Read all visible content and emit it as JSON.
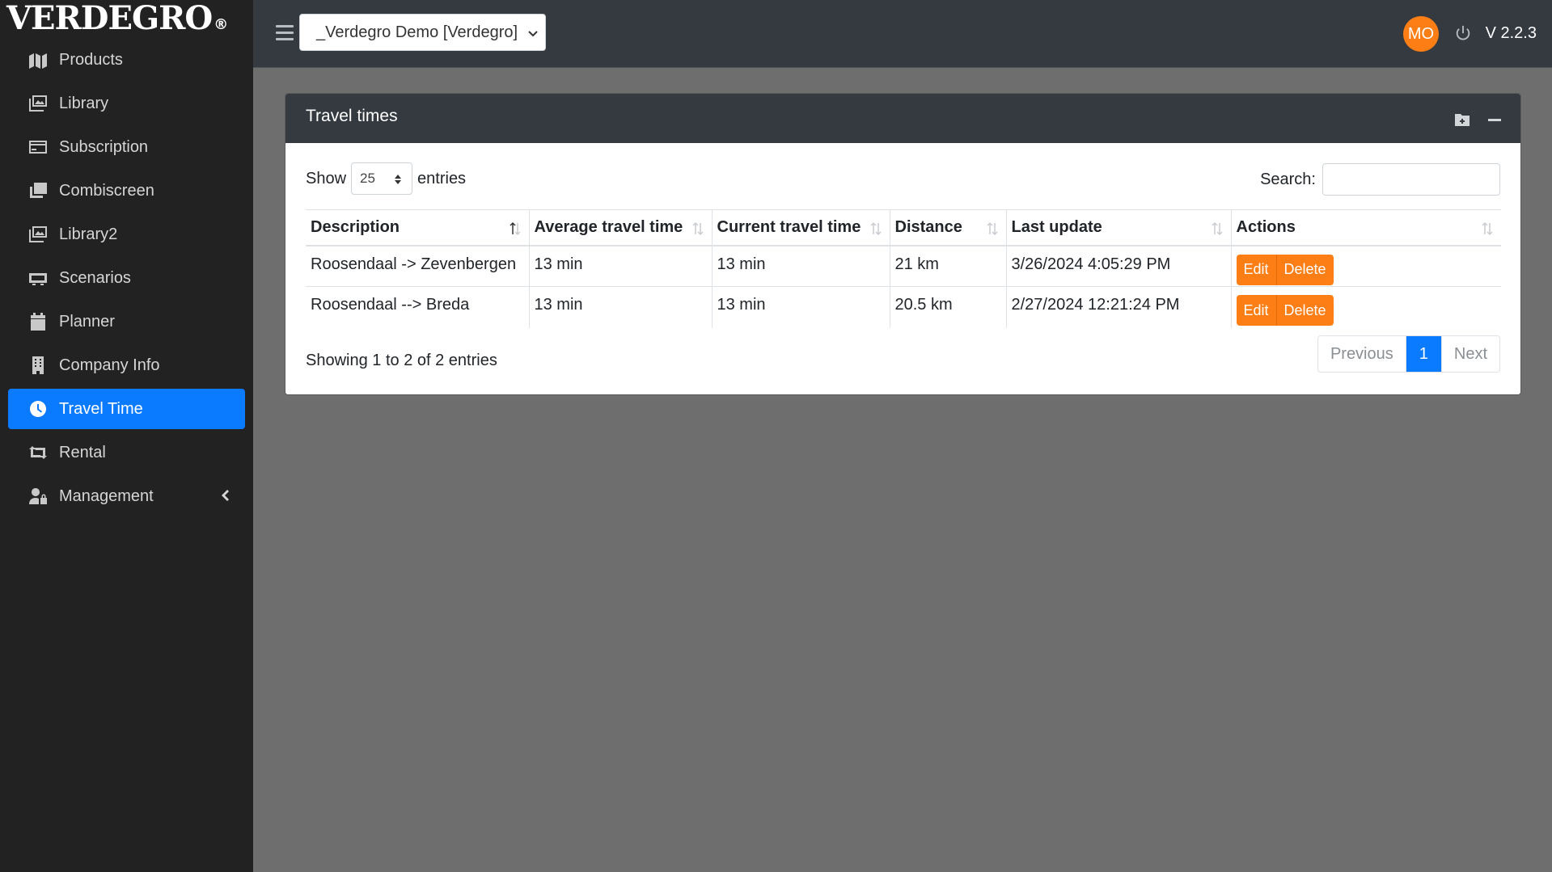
{
  "brand": {
    "name": "VERDEGRO",
    "reg_mark": "®"
  },
  "sidebar": {
    "items": [
      {
        "label": "Products",
        "icon": "map-icon"
      },
      {
        "label": "Library",
        "icon": "images-icon"
      },
      {
        "label": "Subscription",
        "icon": "credit-card-icon"
      },
      {
        "label": "Combiscreen",
        "icon": "clone-icon"
      },
      {
        "label": "Library2",
        "icon": "images-icon"
      },
      {
        "label": "Scenarios",
        "icon": "projector-icon"
      },
      {
        "label": "Planner",
        "icon": "calendar-icon"
      },
      {
        "label": "Company Info",
        "icon": "building-icon"
      },
      {
        "label": "Travel Time",
        "icon": "clock-icon",
        "active": true
      },
      {
        "label": "Rental",
        "icon": "retweet-icon"
      },
      {
        "label": "Management",
        "icon": "user-lock-icon",
        "has_submenu": true
      }
    ]
  },
  "topbar": {
    "tenant": "_Verdegro Demo [Verdegro]",
    "avatar_initials": "MO",
    "version": "V 2.2.3"
  },
  "card": {
    "title": "Travel times",
    "length": {
      "show_label": "Show",
      "value": "25",
      "entries_label": "entries"
    },
    "search_label": "Search:",
    "columns": [
      "Description",
      "Average travel time",
      "Current travel time",
      "Distance",
      "Last update",
      "Actions"
    ],
    "rows": [
      {
        "description": "Roosendaal -> Zevenbergen",
        "avg": "13 min",
        "current": "13 min",
        "distance": "21 km",
        "last_update": "3/26/2024 4:05:29 PM"
      },
      {
        "description": "Roosendaal --> Breda",
        "avg": "13 min",
        "current": "13 min",
        "distance": "20.5 km",
        "last_update": "2/27/2024 12:21:24 PM"
      }
    ],
    "edit_label": "Edit",
    "delete_label": "Delete",
    "info": "Showing 1 to 2 of 2 entries",
    "pager": {
      "previous": "Previous",
      "current": "1",
      "next": "Next"
    }
  },
  "colors": {
    "accent": "#0a7bff",
    "action": "#fd7e14",
    "sidebar_bg": "#222222",
    "topbar_bg": "#343a40"
  }
}
